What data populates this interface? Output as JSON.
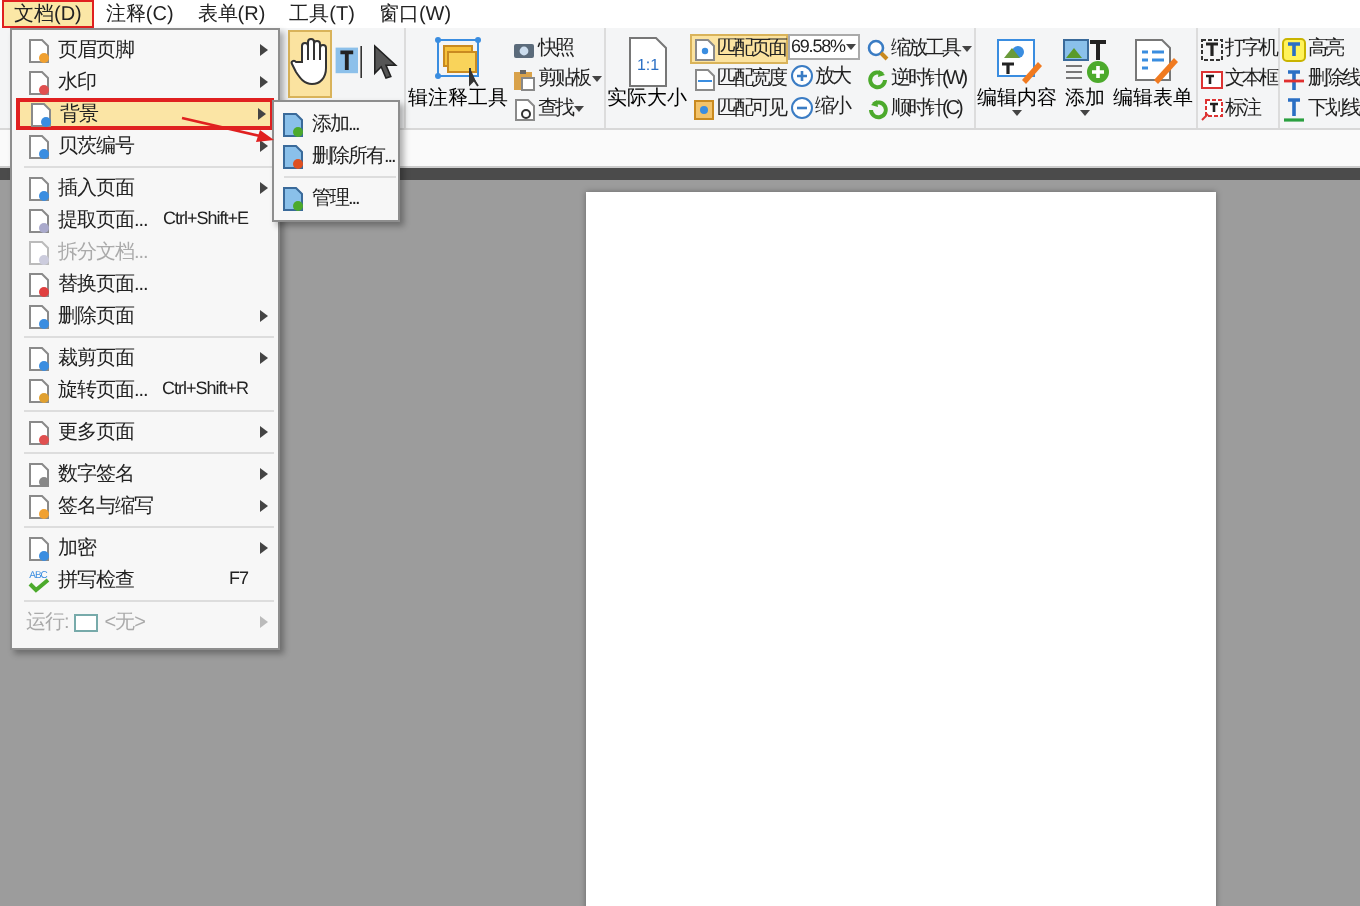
{
  "menubar": [
    {
      "label": "文档(D)",
      "selected": true,
      "highlighted": true
    },
    {
      "label": "注释(C)",
      "selected": false,
      "highlighted": false
    },
    {
      "label": "表单(R)",
      "selected": false,
      "highlighted": false
    },
    {
      "label": "工具(T)",
      "selected": false,
      "highlighted": false
    },
    {
      "label": "窗口(W)",
      "selected": false,
      "highlighted": false
    }
  ],
  "ribbon": {
    "tools": [
      {
        "kind": "hand",
        "selected": true
      },
      {
        "kind": "text-select",
        "selected": false
      },
      {
        "kind": "pointer",
        "selected": false
      }
    ],
    "annotation_tool": {
      "label": "辑注释工具"
    },
    "clipboard": [
      {
        "kind": "snapshot",
        "label": "快照",
        "dropdown": false
      },
      {
        "kind": "clipboard",
        "label": "剪贴板",
        "dropdown": true
      },
      {
        "kind": "find",
        "label": "查找",
        "dropdown": true
      }
    ],
    "actual_size": {
      "label": "实际大小",
      "icon_text": "1:1"
    },
    "fit": [
      {
        "kind": "fit-page",
        "label": "匹配页面",
        "selected": true
      },
      {
        "kind": "fit-width",
        "label": "匹配宽度",
        "selected": false
      },
      {
        "kind": "fit-visible",
        "label": "匹配可见",
        "selected": false
      }
    ],
    "zoom": {
      "value": "69.58%"
    },
    "zoom_buttons": [
      {
        "kind": "zoom-in",
        "label": "放大"
      },
      {
        "kind": "zoom-out",
        "label": "缩小"
      }
    ],
    "view_tools": [
      {
        "kind": "zoom-tool",
        "label": "缩放工具",
        "dropdown": true
      },
      {
        "kind": "ccw",
        "label": "逆时针(W)",
        "dropdown": false
      },
      {
        "kind": "cw",
        "label": "顺时针(C)",
        "dropdown": false
      }
    ],
    "edit": [
      {
        "kind": "edit-content",
        "label": "编辑内容",
        "dropdown": true
      },
      {
        "kind": "add",
        "label": "添加",
        "dropdown": true
      },
      {
        "kind": "edit-form",
        "label": "编辑表单",
        "dropdown": false
      }
    ],
    "comment_columns": [
      [
        {
          "kind": "typewriter",
          "label": "打字机"
        },
        {
          "kind": "textbox",
          "label": "文本框"
        },
        {
          "kind": "callout",
          "label": "标注"
        }
      ],
      [
        {
          "kind": "highlight",
          "label": "高亮"
        },
        {
          "kind": "strikeout",
          "label": "删除线"
        },
        {
          "kind": "underline",
          "label": "下划线"
        }
      ]
    ]
  },
  "menu": [
    {
      "kind": "item",
      "label": "页眉页脚",
      "submenu": true,
      "disabled": false,
      "selected": false,
      "highlighted": false
    },
    {
      "kind": "item",
      "label": "水印",
      "submenu": true,
      "disabled": false,
      "selected": false,
      "highlighted": false
    },
    {
      "kind": "item",
      "label": "背景",
      "submenu": true,
      "disabled": false,
      "selected": true,
      "highlighted": true,
      "children": [
        {
          "kind": "item",
          "label": "添加..."
        },
        {
          "kind": "item",
          "label": "删除所有..."
        },
        {
          "kind": "separator"
        },
        {
          "kind": "item",
          "label": "管理..."
        }
      ]
    },
    {
      "kind": "item",
      "label": "贝茨编号",
      "submenu": true,
      "disabled": false,
      "selected": false,
      "highlighted": false
    },
    {
      "kind": "separator"
    },
    {
      "kind": "item",
      "label": "插入页面",
      "submenu": true,
      "disabled": false,
      "selected": false,
      "highlighted": false
    },
    {
      "kind": "item",
      "label": "提取页面...",
      "shortcut": "Ctrl+Shift+E",
      "submenu": false,
      "disabled": false,
      "selected": false,
      "highlighted": false
    },
    {
      "kind": "item",
      "label": "拆分文档...",
      "submenu": false,
      "disabled": true,
      "selected": false,
      "highlighted": false
    },
    {
      "kind": "item",
      "label": "替换页面...",
      "submenu": false,
      "disabled": false,
      "selected": false,
      "highlighted": false
    },
    {
      "kind": "item",
      "label": "删除页面",
      "submenu": true,
      "disabled": false,
      "selected": false,
      "highlighted": false
    },
    {
      "kind": "separator"
    },
    {
      "kind": "item",
      "label": "裁剪页面",
      "submenu": true,
      "disabled": false,
      "selected": false,
      "highlighted": false
    },
    {
      "kind": "item",
      "label": "旋转页面...",
      "shortcut": "Ctrl+Shift+R",
      "submenu": false,
      "disabled": false,
      "selected": false,
      "highlighted": false
    },
    {
      "kind": "separator"
    },
    {
      "kind": "item",
      "label": "更多页面",
      "submenu": true,
      "disabled": false,
      "selected": false,
      "highlighted": false
    },
    {
      "kind": "separator"
    },
    {
      "kind": "item",
      "label": "数字签名",
      "submenu": true,
      "disabled": false,
      "selected": false,
      "highlighted": false
    },
    {
      "kind": "item",
      "label": "签名与缩写",
      "submenu": true,
      "disabled": false,
      "selected": false,
      "highlighted": false
    },
    {
      "kind": "separator"
    },
    {
      "kind": "item",
      "label": "加密",
      "submenu": true,
      "disabled": false,
      "selected": false,
      "highlighted": false
    },
    {
      "kind": "item",
      "label": "拼写检查",
      "shortcut": "F7",
      "icon_text": "ABC",
      "submenu": false,
      "disabled": false,
      "selected": false,
      "highlighted": false
    },
    {
      "kind": "separator"
    },
    {
      "kind": "run",
      "label": "运行:",
      "value": "<无>",
      "submenu": true,
      "disabled": true,
      "selected": false,
      "highlighted": false
    }
  ],
  "callout_arrow": true
}
